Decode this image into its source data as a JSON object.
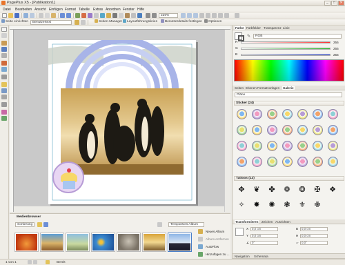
{
  "window": {
    "title": "PagePlus X5 - [Publikation1]",
    "minimize": "_",
    "maximize": "□",
    "close": "✕"
  },
  "menu": [
    "Datei",
    "Bearbeiten",
    "Ansicht",
    "Einfügen",
    "Format",
    "Tabelle",
    "Extras",
    "Anordnen",
    "Fenster",
    "Hilfe"
  ],
  "toolbar1": {
    "zoom": "226%"
  },
  "toolbar2": {
    "page_setup": "Seite einrichten",
    "user_text": "Benutzertext",
    "page_manager": "Seiten-Manager",
    "layout_guides": "Layoutführungslinien",
    "user_details": "Benutzerdetails festlegen",
    "options": "Optionen"
  },
  "right": {
    "color_tabs": [
      "Farbe",
      "Farbfelder",
      "Transparenz",
      "Linie"
    ],
    "color_model": "RGB",
    "channels": [
      {
        "label": "R",
        "value": "255",
        "color": "#ff3030"
      },
      {
        "label": "G",
        "value": "255",
        "color": "#30c030"
      },
      {
        "label": "B",
        "value": "255",
        "color": "#3050ff"
      }
    ],
    "gallery_tabs": [
      "Seiten",
      "Ebenen",
      "Formatvorlagen",
      "Galerie"
    ],
    "gallery_category": "Pläne",
    "sticker_header": "Sticker (24)",
    "tattoo_header": "Tattoos (13)",
    "tattoos": [
      "✥",
      "❦",
      "✤",
      "❁",
      "❂",
      "✠",
      "❖",
      "✧",
      "✸",
      "✺",
      "❃",
      "⚜",
      "✙"
    ],
    "transform_tabs": [
      "Transformieren",
      "Zeichen",
      "Ausrichten"
    ],
    "fields": [
      {
        "label": "X",
        "value": "0,0 cm"
      },
      {
        "label": "Y",
        "value": "0,0 cm"
      },
      {
        "label": "B",
        "value": "0,0 cm"
      },
      {
        "label": "H",
        "value": "0,0 cm"
      },
      {
        "label": "∠",
        "value": "0°"
      },
      {
        "label": "",
        "value": "0,0°"
      }
    ],
    "bottom_tabs": [
      "Navigation",
      "Schemata"
    ]
  },
  "media": {
    "title": "Medienbrowser",
    "sort": "Sortierung",
    "album": "Temporäres Album",
    "new_album": "Neues Album",
    "remove_album": "Album entfernen",
    "autoflow": "AutoFlow",
    "add_files": "Hinzufügen zu ..."
  },
  "status": {
    "page": "1 von 1",
    "ready": "Bereit"
  },
  "colors": {
    "accent": "#e8742a",
    "arc": "#a8b4e8",
    "sticker_border": "#8a85a8"
  }
}
